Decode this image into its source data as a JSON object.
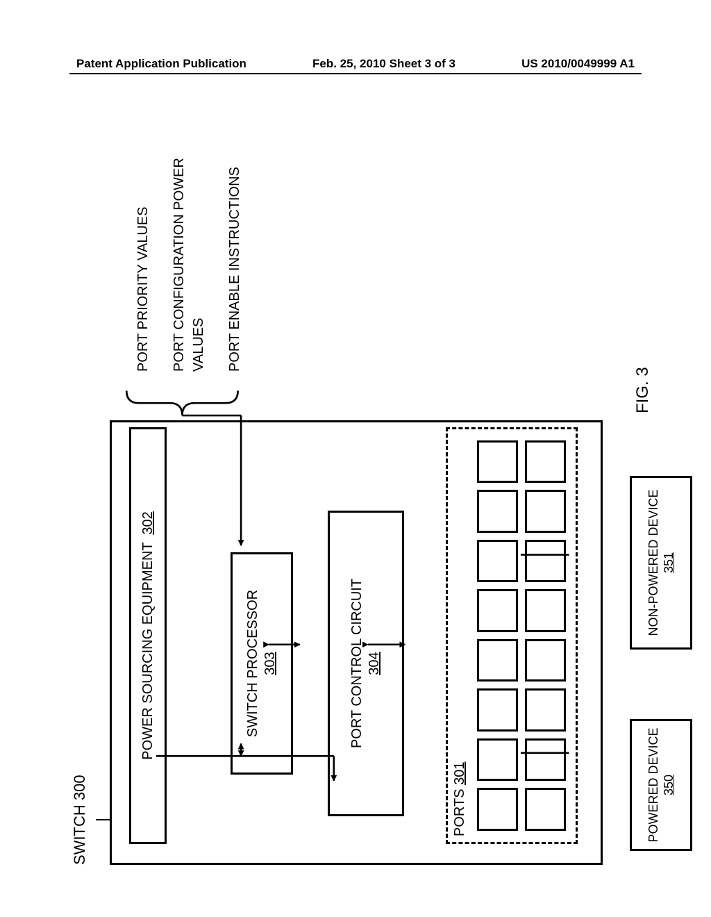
{
  "header": {
    "left": "Patent Application Publication",
    "center": "Feb. 25, 2010  Sheet 3 of 3",
    "right": "US 2010/0049999 A1"
  },
  "diagram": {
    "switch_label": "SWITCH 300",
    "fig_label": "FIG. 3",
    "pse": {
      "label": "POWER SOURCING EQUIPMENT",
      "ref": "302"
    },
    "sp": {
      "label": "SWITCH PROCESSOR",
      "ref": "303"
    },
    "pcc": {
      "label": "PORT CONTROL CIRCUIT",
      "ref": "304"
    },
    "ports": {
      "label": "PORTS",
      "ref": "301",
      "count": 16
    },
    "powered": {
      "label": "POWERED DEVICE",
      "ref": "350"
    },
    "nonpowered": {
      "label": "NON-POWERED DEVICE",
      "ref": "351"
    },
    "inputs": {
      "a": "PORT PRIORITY VALUES",
      "b": "PORT CONFIGURATION POWER VALUES",
      "c": "PORT ENABLE INSTRUCTIONS"
    }
  }
}
